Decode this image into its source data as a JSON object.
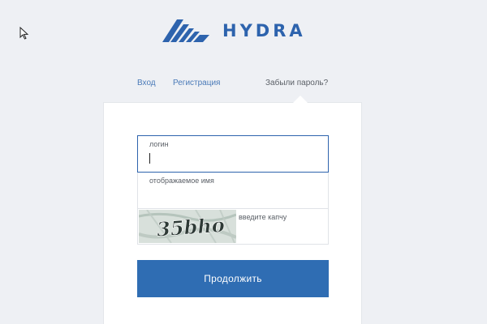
{
  "brand": {
    "name": "HYDRA",
    "color": "#2d63ad",
    "logo_icon": "hydra-logo-icon"
  },
  "nav": {
    "login": "Вход",
    "register": "Регистрация",
    "forgot": "Забыли пароль?"
  },
  "form": {
    "login_label": "логин",
    "display_name_label": "отображаемое имя",
    "captcha_label": "введите капчу",
    "captcha_text": "35bho",
    "submit_label": "Продолжить",
    "button_color": "#2f6db3"
  }
}
